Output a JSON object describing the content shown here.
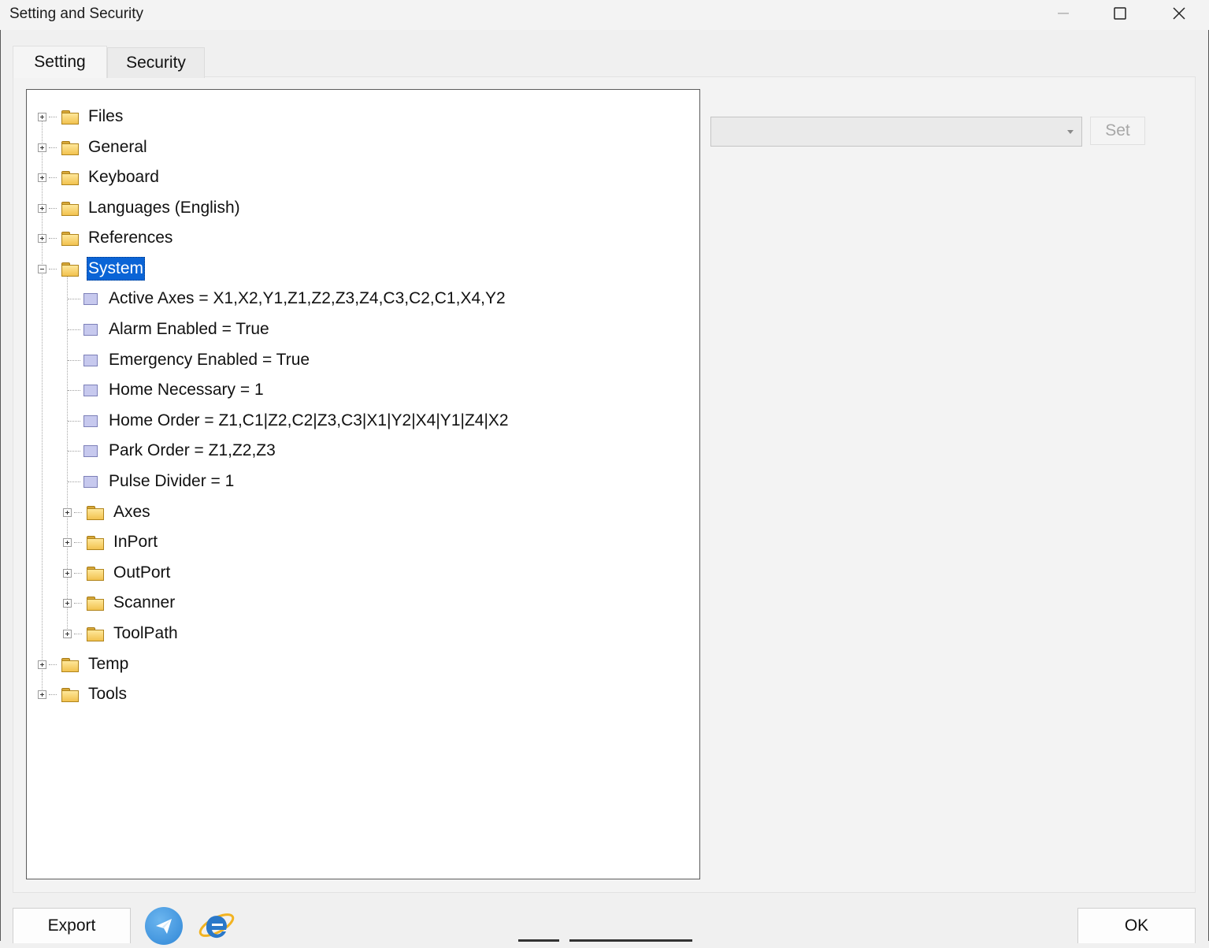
{
  "window": {
    "title": "Setting and Security"
  },
  "tabs": [
    {
      "label": "Setting",
      "active": true
    },
    {
      "label": "Security",
      "active": false
    }
  ],
  "tree": {
    "root": [
      {
        "label": "Files",
        "expanded": false
      },
      {
        "label": "General",
        "expanded": false
      },
      {
        "label": "Keyboard",
        "expanded": false
      },
      {
        "label": "Languages (English)",
        "expanded": false
      },
      {
        "label": "References",
        "expanded": false
      },
      {
        "label": "System",
        "expanded": true,
        "selected": true
      },
      {
        "label": "Temp",
        "expanded": false
      },
      {
        "label": "Tools",
        "expanded": false
      }
    ],
    "system_values": [
      "Active Axes = X1,X2,Y1,Z1,Z2,Z3,Z4,C3,C2,C1,X4,Y2",
      "Alarm Enabled = True",
      "Emergency Enabled = True",
      "Home Necessary = 1",
      "Home Order = Z1,C1|Z2,C2|Z3,C3|X1|Y2|X4|Y1|Z4|X2",
      "Park Order = Z1,Z2,Z3",
      "Pulse Divider = 1"
    ],
    "system_folders": [
      "Axes",
      "InPort",
      "OutPort",
      "Scanner",
      "ToolPath"
    ]
  },
  "editor": {
    "combo_value": "",
    "set_label": "Set"
  },
  "footer": {
    "export_label": "Export",
    "ok_label": "OK"
  },
  "colors": {
    "selection": "#0a64d6",
    "folder": "#f2c24f",
    "leaf_icon": "#c7c9ee"
  }
}
